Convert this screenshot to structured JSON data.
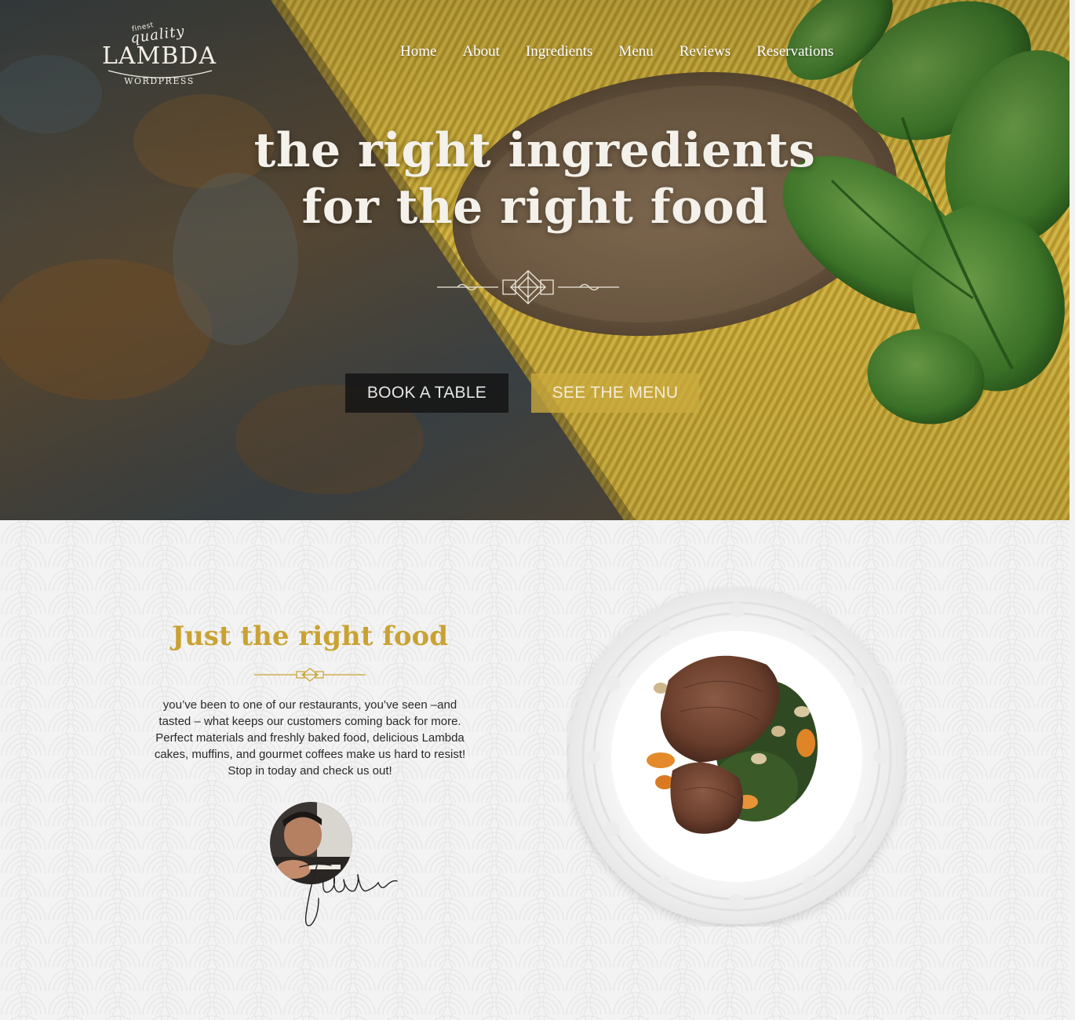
{
  "logo": {
    "finest": "finest",
    "quality": "quality",
    "name": "LAMBDA",
    "sub": "WORDPRESS"
  },
  "nav": {
    "items": [
      "Home",
      "About",
      "Ingredients",
      "Menu",
      "Reviews",
      "Reservations"
    ]
  },
  "hero": {
    "title_line1": "the right ingredients",
    "title_line2": "for the right food",
    "book_label": "BOOK A TABLE",
    "menu_label": "SEE THE MENU"
  },
  "about": {
    "title": "Just the right food",
    "text": "you’ve been to one of our restaurants, you’ve seen –and tasted – what keeps our customers coming back for more. Perfect materials and freshly baked food, delicious Lambda cakes, muffins, and gourmet coffees make us hard to resist! Stop in today and check us out!"
  },
  "colors": {
    "accent_gold": "#c9a232",
    "button_dark": "#141414",
    "button_gold": "#cbaa3e"
  }
}
